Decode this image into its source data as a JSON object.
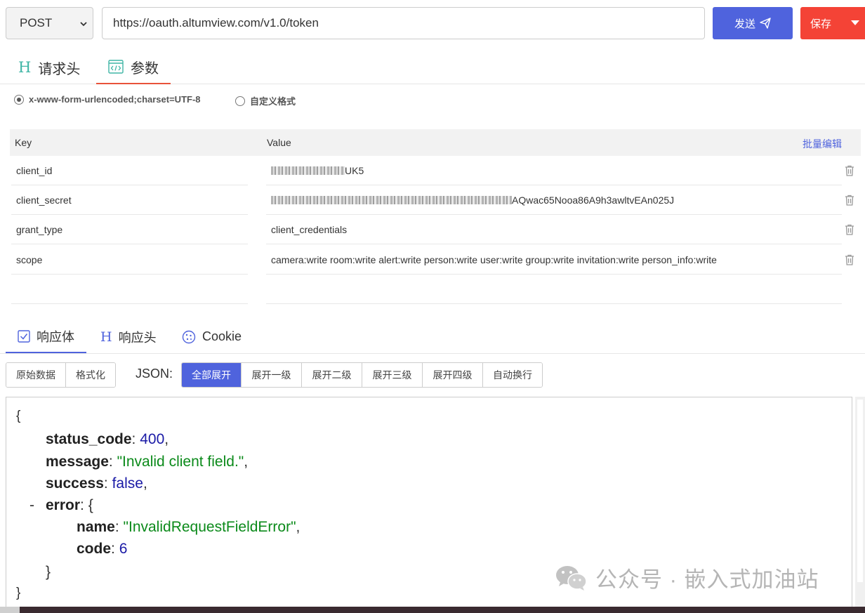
{
  "request": {
    "method": "POST",
    "url": "https://oauth.altumview.com/v1.0/token",
    "send_label": "发送",
    "save_label": "保存"
  },
  "request_tabs": [
    {
      "label": "请求头",
      "icon": "header-h-icon",
      "active": false
    },
    {
      "label": "参数",
      "icon": "code-window-icon",
      "active": true
    }
  ],
  "content_types": [
    {
      "label": "x-www-form-urlencoded;charset=UTF-8",
      "selected": true
    },
    {
      "label": "自定义格式",
      "selected": false
    }
  ],
  "params": {
    "header_key": "Key",
    "header_value": "Value",
    "bulk_edit_label": "批量编辑",
    "rows": [
      {
        "key": "client_id",
        "value_visible": "UK5",
        "redacted": true
      },
      {
        "key": "client_secret",
        "value_visible": "AQwac65Nooa86A9h3awltvEAn025J",
        "redacted": true
      },
      {
        "key": "grant_type",
        "value_visible": "client_credentials",
        "redacted": false
      },
      {
        "key": "scope",
        "value_visible": "camera:write room:write alert:write person:write user:write group:write invitation:write person_info:write",
        "redacted": false
      }
    ]
  },
  "response_tabs": [
    {
      "label": "响应体",
      "icon": "checkbox-icon",
      "active": true
    },
    {
      "label": "响应头",
      "icon": "header-h-icon",
      "active": false
    },
    {
      "label": "Cookie",
      "icon": "cookie-icon",
      "active": false
    }
  ],
  "view_modes": [
    "原始数据",
    "格式化"
  ],
  "json_label": "JSON:",
  "expand_options": [
    {
      "label": "全部展开",
      "selected": true
    },
    {
      "label": "展开一级",
      "selected": false
    },
    {
      "label": "展开二级",
      "selected": false
    },
    {
      "label": "展开三级",
      "selected": false
    },
    {
      "label": "展开四级",
      "selected": false
    },
    {
      "label": "自动换行",
      "selected": false
    }
  ],
  "response_json": {
    "open_brace": "{",
    "close_brace": "}",
    "status_code_key": "status_code",
    "status_code_value": "400",
    "message_key": "message",
    "message_value": "\"Invalid client field.\"",
    "success_key": "success",
    "success_value": "false",
    "collapse_marker": "-",
    "error_key": "error",
    "error_name_key": "name",
    "error_name_value": "\"InvalidRequestFieldError\"",
    "error_code_key": "code",
    "error_code_value": "6"
  },
  "watermark": "公众号 · 嵌入式加油站",
  "colors": {
    "primary": "#4f63dd",
    "danger": "#f44336",
    "tab_accent": "#e8533a",
    "json_string": "#0b8a1a",
    "json_number": "#1a1aa6"
  }
}
